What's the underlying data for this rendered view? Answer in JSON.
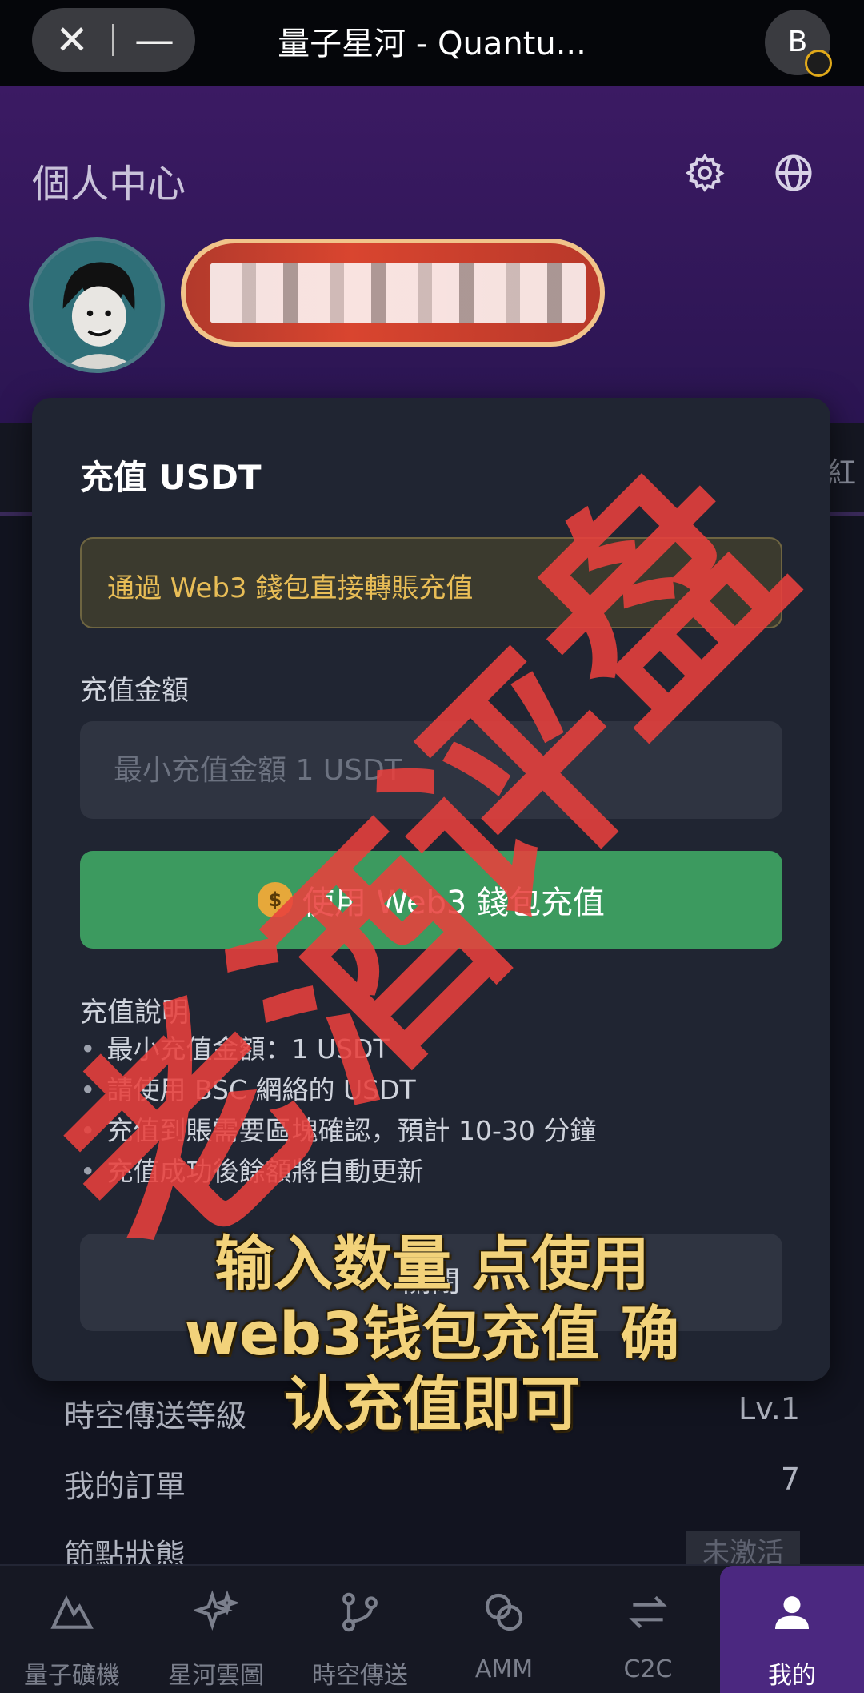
{
  "browser": {
    "close_label": "✕",
    "minimize_label": "—",
    "tab_title": "量子星河 - Quantu...",
    "profile_initial": "B"
  },
  "header": {
    "title": "個人中心"
  },
  "background": {
    "tab_edge_text": "紅",
    "rows": [
      {
        "label": "時空傳送等級",
        "value": "Lv.1"
      },
      {
        "label": "我的訂單",
        "value": "7"
      },
      {
        "label": "節點狀態",
        "badge": "未激活"
      }
    ]
  },
  "modal": {
    "title": "充值 USDT",
    "notice": "通過 Web3 錢包直接轉賬充值",
    "amount_label": "充值金額",
    "amount_placeholder": "最小充值金額 1 USDT",
    "pay_button": "使用 Web3 錢包充值",
    "notes_title": "充值說明",
    "notes": [
      "最小充值金額：1 USDT",
      "請使用 BSC 網絡的 USDT",
      "充值到賬需要區塊確認，預計 10-30 分鐘",
      "充值成功後餘額將自動更新"
    ],
    "close_button": "關閉"
  },
  "bottom_nav": [
    {
      "label": "量子礦機",
      "icon": "mountain-icon",
      "active": false
    },
    {
      "label": "星河雲圖",
      "icon": "sparkle-icon",
      "active": false
    },
    {
      "label": "時空傳送",
      "icon": "branch-icon",
      "active": false
    },
    {
      "label": "AMM",
      "icon": "coins-icon",
      "active": false
    },
    {
      "label": "C2C",
      "icon": "swap-icon",
      "active": false
    },
    {
      "label": "我的",
      "icon": "user-icon",
      "active": true
    }
  ],
  "overlay": {
    "watermark": "老酒评盘",
    "caption_line1": "输入数量 点使用",
    "caption_line2": "web3钱包充值 确",
    "caption_line3": "认充值即可"
  },
  "colors": {
    "accent_purple": "#4b2880",
    "pay_green": "#3c9a5f",
    "notice_gold": "#e8bd56",
    "watermark_red": "#e8403c"
  }
}
